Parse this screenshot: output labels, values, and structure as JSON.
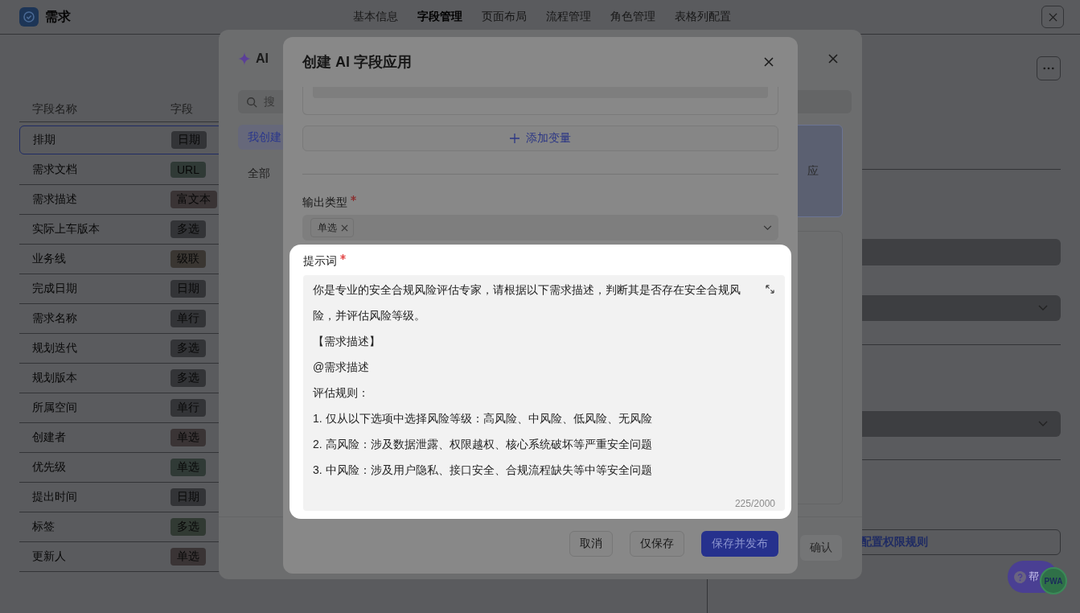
{
  "app": {
    "title": "需求"
  },
  "nav_tabs": [
    {
      "label": "基本信息",
      "selected": false
    },
    {
      "label": "字段管理",
      "selected": true
    },
    {
      "label": "页面布局",
      "selected": false
    },
    {
      "label": "流程管理",
      "selected": false
    },
    {
      "label": "角色管理",
      "selected": false
    },
    {
      "label": "表格列配置",
      "selected": false
    }
  ],
  "fields_table": {
    "columns": [
      "字段名称",
      "字段"
    ],
    "rows": [
      {
        "name": "排期",
        "type": "日期",
        "color": "#333437",
        "selected": true
      },
      {
        "name": "需求文档",
        "type": "URL",
        "color": "#303a36",
        "selected": false
      },
      {
        "name": "需求描述",
        "type": "富文本",
        "color": "#3a3435",
        "selected": false
      },
      {
        "name": "实际上车版本",
        "type": "多选",
        "color": "#333437",
        "selected": false
      },
      {
        "name": "业务线",
        "type": "级联",
        "color": "#3a3632",
        "selected": false
      },
      {
        "name": "完成日期",
        "type": "日期",
        "color": "#333437",
        "selected": false
      },
      {
        "name": "需求名称",
        "type": "单行",
        "color": "#333437",
        "selected": false
      },
      {
        "name": "规划迭代",
        "type": "多选",
        "color": "#333437",
        "selected": false
      },
      {
        "name": "规划版本",
        "type": "多选",
        "color": "#333437",
        "selected": false
      },
      {
        "name": "所属空间",
        "type": "单行",
        "color": "#333437",
        "selected": false
      },
      {
        "name": "创建者",
        "type": "单选",
        "color": "#3a3435",
        "selected": false
      },
      {
        "name": "优先级",
        "type": "单选",
        "color": "#303a36",
        "selected": false
      },
      {
        "name": "提出时间",
        "type": "日期",
        "color": "#333437",
        "selected": false
      },
      {
        "name": "标签",
        "type": "多选",
        "color": "#313a33",
        "selected": false
      },
      {
        "name": "更新人",
        "type": "单选",
        "color": "#3a3435",
        "selected": false
      }
    ]
  },
  "right_panel": {
    "permission_button": "配置权限规则"
  },
  "ai_dialog": {
    "title": "AI",
    "search_placeholder": "搜",
    "categories": [
      {
        "label": "我创建",
        "selected": true
      },
      {
        "label": "全部",
        "selected": false
      }
    ],
    "card_text": "应",
    "confirm_button": "确认"
  },
  "create_dialog": {
    "title": "创建 AI 字段应用",
    "add_variable": "添加变量",
    "output_type": {
      "label": "输出类型",
      "required": true,
      "tags": [
        "单选"
      ]
    },
    "prompt": {
      "label": "提示词",
      "required": true,
      "paragraphs": [
        "你是专业的安全合规风险评估专家，请根据以下需求描述，判断其是否存在安全合规风险，并评估风险等级。",
        "【需求描述】",
        "@需求描述",
        "评估规则：",
        "1. 仅从以下选项中选择风险等级：高风险、中风险、低风险、无风险",
        "2. 高风险：涉及数据泄露、权限越权、核心系统破坏等严重安全问题",
        "3. 中风险：涉及用户隐私、接口安全、合规流程缺失等中等安全问题"
      ],
      "counter": "225/2000"
    },
    "buttons": [
      {
        "label": "取消",
        "kind": "default"
      },
      {
        "label": "仅保存",
        "kind": "default"
      },
      {
        "label": "保存并发布",
        "kind": "primary"
      }
    ]
  },
  "help": {
    "label": "帮",
    "badge": "PWA"
  }
}
